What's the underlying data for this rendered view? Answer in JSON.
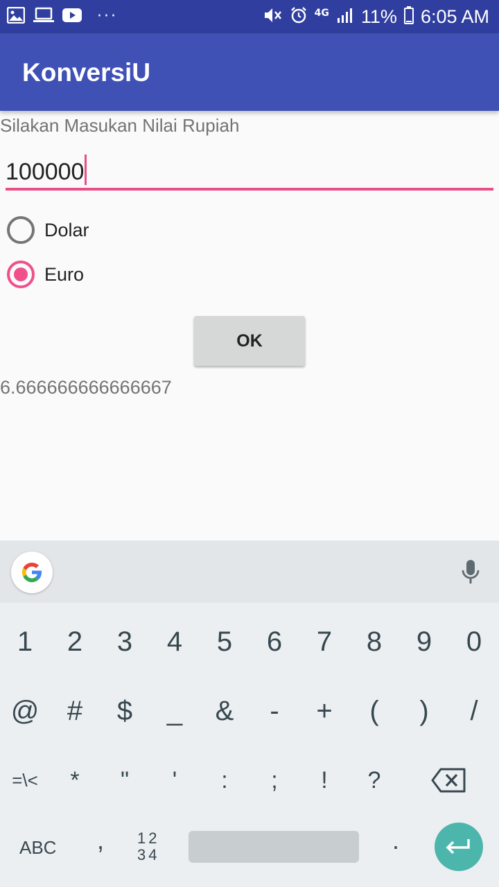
{
  "status_bar": {
    "time": "6:05 AM",
    "battery_percent": "11%",
    "network": "4G",
    "notification_icons": [
      "image-icon",
      "laptop-icon",
      "youtube-icon"
    ],
    "more_indicator": "···"
  },
  "app_bar": {
    "title": "KonversiU",
    "color": "#3f51b5"
  },
  "form": {
    "prompt_label": "Silakan Masukan Nilai Rupiah",
    "amount_value": "100000",
    "options": [
      {
        "label": "Dolar",
        "checked": false
      },
      {
        "label": "Euro",
        "checked": true
      }
    ],
    "ok_label": "OK",
    "result": "6.666666666666667",
    "accent_color": "#f0508a"
  },
  "keyboard": {
    "row1": [
      "1",
      "2",
      "3",
      "4",
      "5",
      "6",
      "7",
      "8",
      "9",
      "0"
    ],
    "row2": [
      "@",
      "#",
      "$",
      "_",
      "&",
      "-",
      "+",
      "(",
      ")",
      "/"
    ],
    "row3": [
      "=\\<",
      "*",
      "\"",
      "'",
      ":",
      ";",
      "!",
      "?"
    ],
    "abc_label": "ABC",
    "comma_label": ",",
    "num_label_top": "12",
    "num_label_bottom": "34",
    "period_label": ".",
    "enter_color": "#4db6ac"
  }
}
